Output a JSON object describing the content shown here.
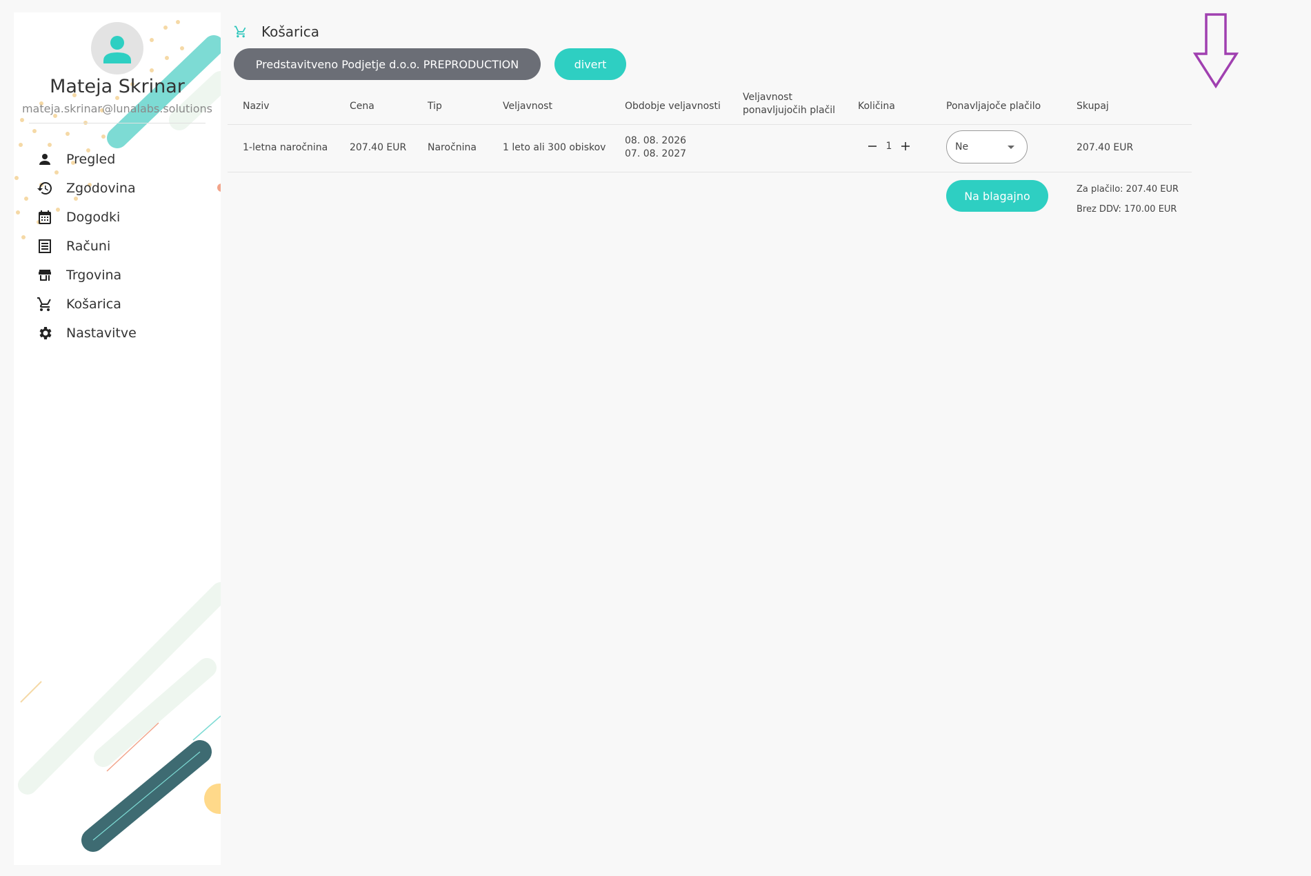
{
  "sidebar": {
    "user_name": "Mateja Skrinar",
    "user_email": "mateja.skrinar@lunalabs.solutions",
    "items": [
      {
        "label": "Pregled",
        "icon": "person-icon"
      },
      {
        "label": "Zgodovina",
        "icon": "history-icon"
      },
      {
        "label": "Dogodki",
        "icon": "calendar-icon"
      },
      {
        "label": "Računi",
        "icon": "receipt-icon"
      },
      {
        "label": "Trgovina",
        "icon": "store-icon"
      },
      {
        "label": "Košarica",
        "icon": "cart-icon"
      },
      {
        "label": "Nastavitve",
        "icon": "gear-icon"
      }
    ]
  },
  "page": {
    "title": "Košarica",
    "company_button": "Predstavitveno Podjetje d.o.o. PREPRODUCTION",
    "divert_button": "divert"
  },
  "table": {
    "headers": [
      "Naziv",
      "Cena",
      "Tip",
      "Veljavnost",
      "Obdobje veljavnosti",
      "Veljavnost ponavljujočih plačil",
      "Količina",
      "Ponavljajoče plačilo",
      "Skupaj"
    ],
    "row": {
      "name": "1-letna naročnina",
      "price": "207.40 EUR",
      "type": "Naročnina",
      "validity": "1 leto ali 300 obiskov",
      "period_start": "08. 08. 2026",
      "period_end": "07. 08. 2027",
      "recurring_validity": "",
      "quantity": "1",
      "recurring_payment": "Ne",
      "total": "207.40 EUR"
    }
  },
  "summary": {
    "checkout_button": "Na blagajno",
    "to_pay": "Za plačilo: 207.40 EUR",
    "without_vat": "Brez DDV: 170.00 EUR"
  },
  "colors": {
    "accent": "#2ecfc2",
    "company_button": "#6b6e76",
    "annotation_arrow": "#a040b0"
  }
}
